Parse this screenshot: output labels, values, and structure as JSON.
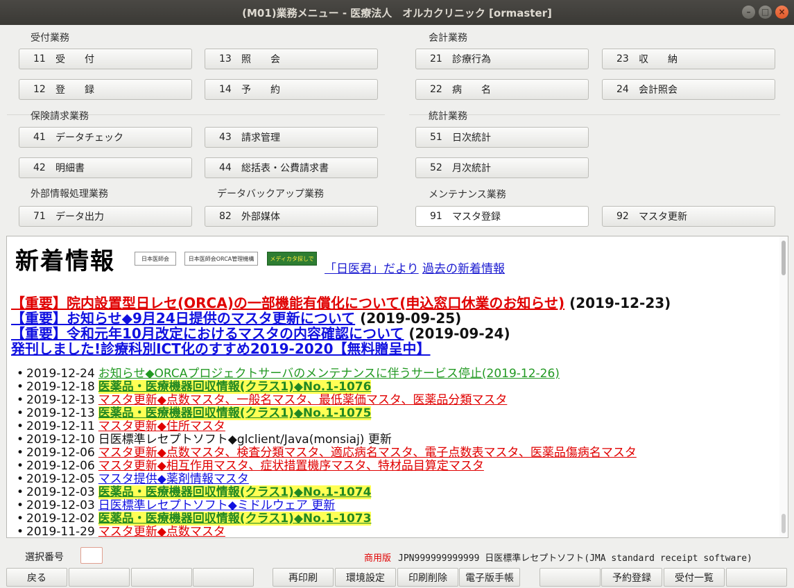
{
  "window": {
    "title": "(M01)業務メニュー - 医療法人　オルカクリニック [ormaster]"
  },
  "sections": {
    "uketsuke": "受付業務",
    "kaikei": "会計業務",
    "hoken": "保険請求業務",
    "toukei": "統計業務",
    "gaibu": "外部情報処理業務",
    "backup": "データバックアップ業務",
    "maint": "メンテナンス業務"
  },
  "menu": {
    "b11": {
      "num": "11",
      "label": "受　　付"
    },
    "b13": {
      "num": "13",
      "label": "照　　会"
    },
    "b21": {
      "num": "21",
      "label": "診療行為"
    },
    "b23": {
      "num": "23",
      "label": "収　　納"
    },
    "b12": {
      "num": "12",
      "label": "登　　録"
    },
    "b14": {
      "num": "14",
      "label": "予　　約"
    },
    "b22": {
      "num": "22",
      "label": "病　　名"
    },
    "b24": {
      "num": "24",
      "label": "会計照会"
    },
    "b41": {
      "num": "41",
      "label": "データチェック"
    },
    "b43": {
      "num": "43",
      "label": "請求管理"
    },
    "b51": {
      "num": "51",
      "label": "日次統計"
    },
    "b42": {
      "num": "42",
      "label": "明細書"
    },
    "b44": {
      "num": "44",
      "label": "総括表・公費請求書"
    },
    "b52": {
      "num": "52",
      "label": "月次統計"
    },
    "b71": {
      "num": "71",
      "label": "データ出力"
    },
    "b82": {
      "num": "82",
      "label": "外部媒体"
    },
    "b91": {
      "num": "91",
      "label": "マスタ登録"
    },
    "b92": {
      "num": "92",
      "label": "マスタ更新"
    }
  },
  "news": {
    "title": "新着情報",
    "logos": [
      "日本医師会",
      "日本医師会ORCA管理機構",
      "メディカタ探しで"
    ],
    "link_nichii": "「日医君」だより",
    "link_past": "過去の新着情報",
    "headlines": [
      {
        "text": "【重要】院内設置型日レセ(ORCA)の一部機能有償化について(申込窓口休業のお知らせ)",
        "date": " (2019-12-23)"
      },
      {
        "text": "【重要】お知らせ◆9月24日提供のマスタ更新について",
        "date": " (2019-09-25)"
      },
      {
        "text": "【重要】令和元年10月改定におけるマスタの内容確認について",
        "date": " (2019-09-24)"
      },
      {
        "text": "発刊しました!診療科別ICT化のすすめ2019-2020【無料贈呈中】",
        "date": ""
      }
    ],
    "items": [
      {
        "date": "2019-12-24",
        "text": "お知らせ◆ORCAプロジェクトサーバのメンテナンスに伴うサービス停止(2019-12-26)",
        "style": "green"
      },
      {
        "date": "2019-12-18",
        "text": "医薬品・医療機器回収情報(クラス1)◆No.1-1076",
        "style": "yellow"
      },
      {
        "date": "2019-12-13",
        "text": "マスタ更新◆点数マスタ、一般名マスタ、最低薬価マスタ、医薬品分類マスタ",
        "style": "red"
      },
      {
        "date": "2019-12-13",
        "text": "医薬品・医療機器回収情報(クラス1)◆No.1-1075",
        "style": "yellow"
      },
      {
        "date": "2019-12-11",
        "text": "マスタ更新◆住所マスタ",
        "style": "red"
      },
      {
        "date": "2019-12-10",
        "text": "日医標準レセプトソフト◆glclient/Java(monsiaj) 更新",
        "style": "plain"
      },
      {
        "date": "2019-12-06",
        "text": "マスタ更新◆点数マスタ、検査分類マスタ、適応病名マスタ、電子点数表マスタ、医薬品傷病名マスタ",
        "style": "red"
      },
      {
        "date": "2019-12-06",
        "text": "マスタ更新◆相互作用マスタ、症状措置機序マスタ、特材品目算定マスタ",
        "style": "red"
      },
      {
        "date": "2019-12-05",
        "text": "マスタ提供◆薬剤情報マスタ",
        "style": "blue"
      },
      {
        "date": "2019-12-03",
        "text": "医薬品・医療機器回収情報(クラス1)◆No.1-1074",
        "style": "yellow"
      },
      {
        "date": "2019-12-03",
        "text": "日医標準レセプトソフト◆ミドルウェア 更新",
        "style": "blue"
      },
      {
        "date": "2019-12-02",
        "text": "医薬品・医療機器回収情報(クラス1)◆No.1-1073",
        "style": "yellow"
      },
      {
        "date": "2019-11-29",
        "text": "マスタ更新◆点数マスタ",
        "style": "red"
      }
    ]
  },
  "footer": {
    "select_label": "選択番号",
    "select_value": "",
    "mode": "商用版",
    "version": "JPN999999999999 日医標準レセプトソフト(JMA standard receipt software)",
    "buttons": [
      "戻る",
      "",
      "",
      "",
      "再印刷",
      "環境設定",
      "印刷削除",
      "電子版手帳",
      "",
      "予約登録",
      "受付一覧",
      ""
    ]
  }
}
